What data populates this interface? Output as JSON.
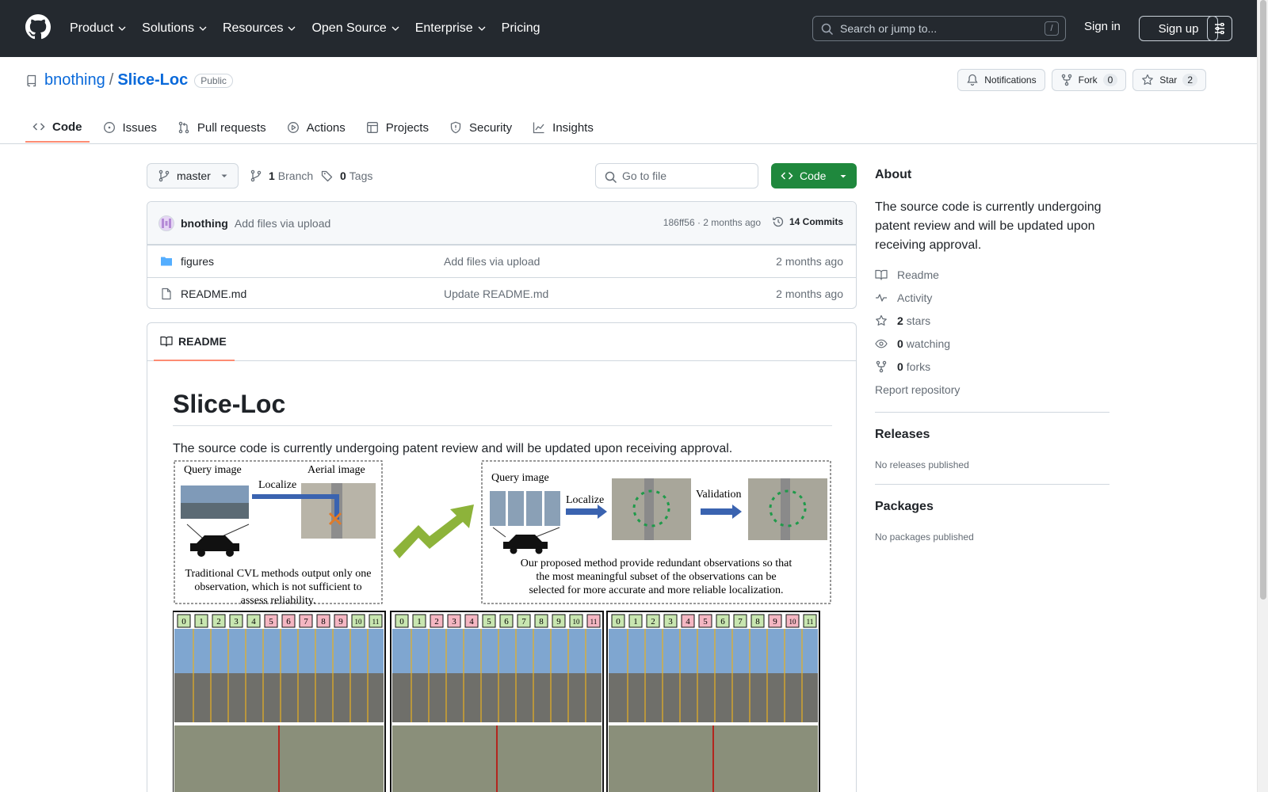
{
  "header": {
    "nav": [
      "Product",
      "Solutions",
      "Resources",
      "Open Source",
      "Enterprise",
      "Pricing"
    ],
    "search_placeholder": "Search or jump to...",
    "search_shortcut": "/",
    "sign_in": "Sign in",
    "sign_up": "Sign up"
  },
  "repo": {
    "owner": "bnothing",
    "separator": "/",
    "name": "Slice-Loc",
    "visibility": "Public",
    "notifications": "Notifications",
    "fork_label": "Fork",
    "fork_count": "0",
    "star_label": "Star",
    "star_count": "2"
  },
  "tabs": [
    "Code",
    "Issues",
    "Pull requests",
    "Actions",
    "Projects",
    "Security",
    "Insights"
  ],
  "toolbar": {
    "branch": "master",
    "branch_count": "1",
    "branch_label": "Branch",
    "tag_count": "0",
    "tag_label": "Tags",
    "goto_placeholder": "Go to file",
    "code_button": "Code"
  },
  "commit": {
    "user": "bnothing",
    "message": "Add files via upload",
    "hash_time": "186ff56 · 2 months ago",
    "commits": "14 Commits"
  },
  "files": [
    {
      "name": "figures",
      "type": "folder",
      "message": "Add files via upload",
      "time": "2 months ago"
    },
    {
      "name": "README.md",
      "type": "file",
      "message": "Update README.md",
      "time": "2 months ago"
    }
  ],
  "readme": {
    "tab": "README",
    "title": "Slice-Loc",
    "text": "The source code is currently undergoing patent review and will be updated upon receiving approval.",
    "figure": {
      "left_query": "Query image",
      "left_aerial": "Aerial image",
      "left_localize": "Localize",
      "left_caption": [
        "Traditional CVL methods output only one",
        "observation, which is not sufficient to",
        "assess reliability."
      ],
      "right_query": "Query image",
      "right_localize": "Localize",
      "right_validation": "Validation",
      "right_caption": [
        "Our proposed method provide redundant observations so that",
        "the most meaningful subset of the observations can be",
        "selected for more accurate and more reliable localization."
      ],
      "slice_numbers": [
        "0",
        "1",
        "2",
        "3",
        "4",
        "5",
        "6",
        "7",
        "8",
        "9",
        "10",
        "11"
      ]
    }
  },
  "about": {
    "title": "About",
    "description": "The source code is currently undergoing patent review and will be updated upon receiving approval.",
    "readme": "Readme",
    "activity": "Activity",
    "stars_count": "2",
    "stars_label": "stars",
    "watching_count": "0",
    "watching_label": "watching",
    "forks_count": "0",
    "forks_label": "forks",
    "report": "Report repository"
  },
  "releases": {
    "title": "Releases",
    "empty": "No releases published"
  },
  "packages": {
    "title": "Packages",
    "empty": "No packages published"
  },
  "colors": {
    "header_bg": "#24292f",
    "link": "#0969da",
    "primary_button": "#1f883d",
    "tab_underline": "#fd8c73"
  }
}
